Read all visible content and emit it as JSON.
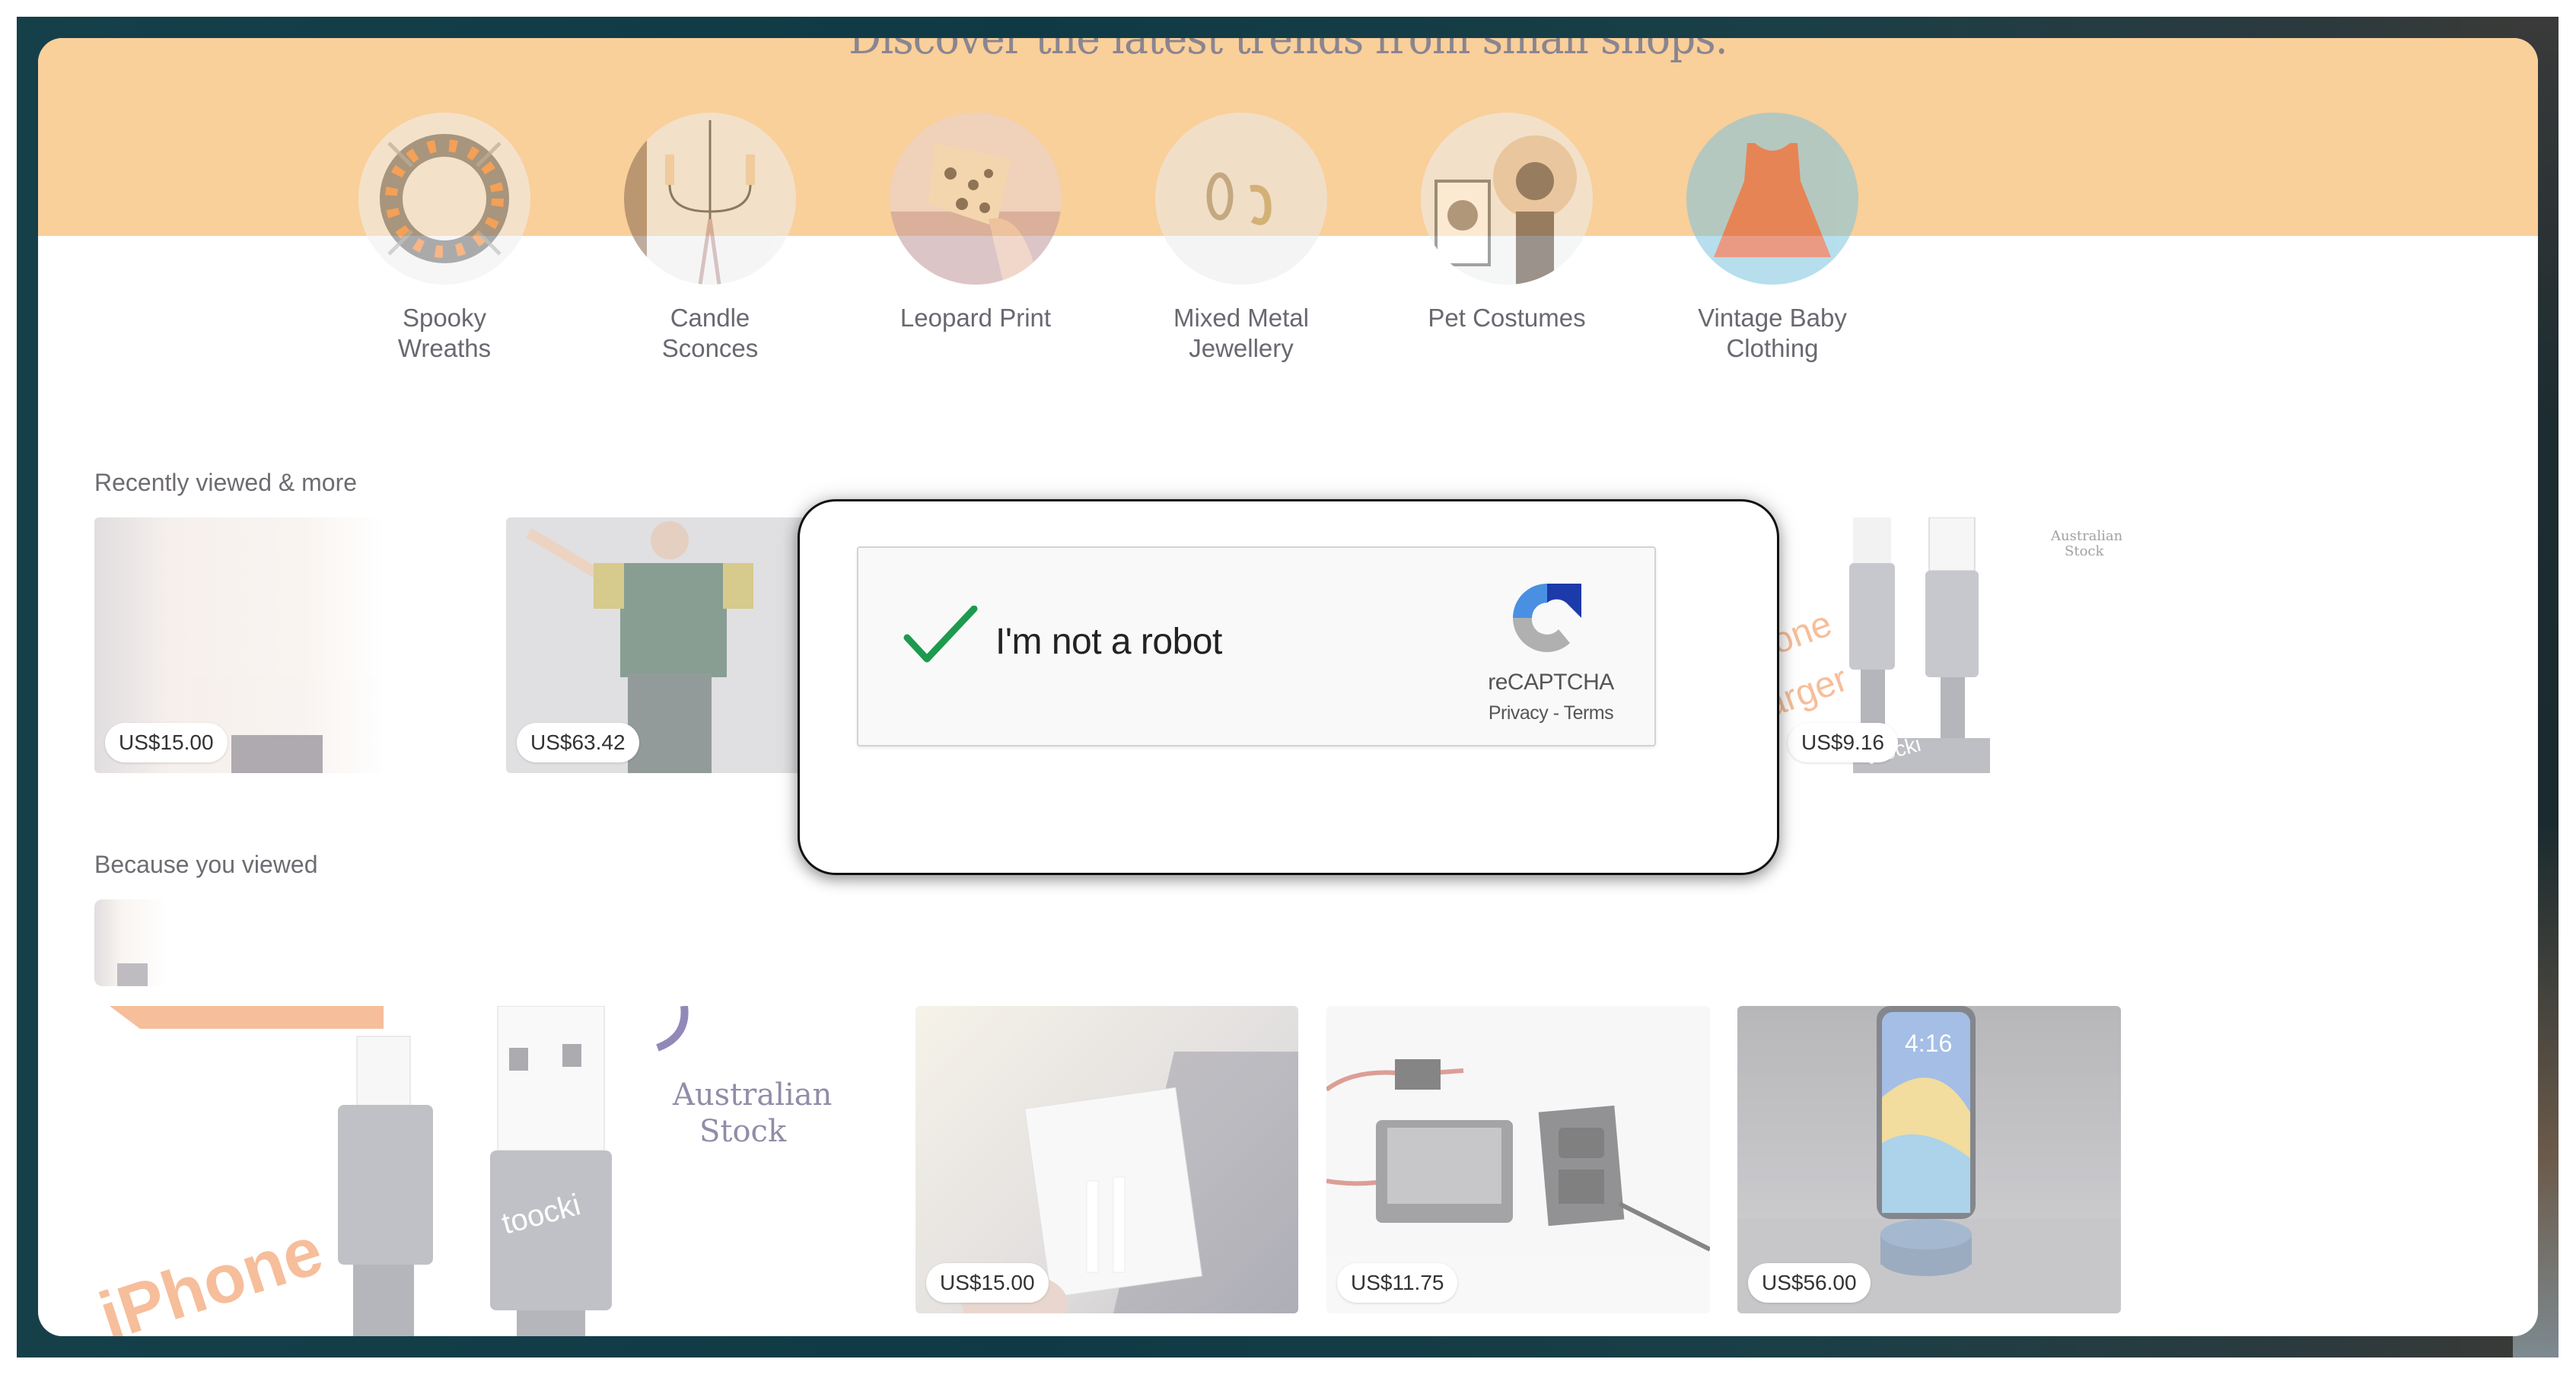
{
  "page": {
    "headline": "Discover the latest trends from small shops."
  },
  "categories": [
    {
      "label": "Spooky Wreaths",
      "line1": "Spooky",
      "line2": "Wreaths",
      "icon": "wreath-image"
    },
    {
      "label": "Candle Sconces",
      "line1": "Candle",
      "line2": "Sconces",
      "icon": "candle-sconce-image"
    },
    {
      "label": "Leopard Print",
      "line1": "Leopard Print",
      "line2": "",
      "icon": "leopard-print-image"
    },
    {
      "label": "Mixed Metal Jewellery",
      "line1": "Mixed Metal",
      "line2": "Jewellery",
      "icon": "earrings-image"
    },
    {
      "label": "Pet Costumes",
      "line1": "Pet Costumes",
      "line2": "",
      "icon": "pet-costume-image"
    },
    {
      "label": "Vintage Baby Clothing",
      "line1": "Vintage Baby",
      "line2": "Clothing",
      "icon": "baby-dress-image"
    }
  ],
  "recently_viewed": {
    "title": "Recently viewed & more",
    "items": [
      {
        "price": "US$15.00",
        "image": "power-adapter-image"
      },
      {
        "price": "US$63.42",
        "image": "tracksuit-image"
      },
      {
        "price": "US$9.16",
        "image": "iphone-charger-cable-image",
        "overlay_text": [
          "one",
          "arger"
        ],
        "caption": [
          "Australian",
          "Stock"
        ],
        "brand": "toocki"
      }
    ]
  },
  "because_you_viewed": {
    "title": "Because you viewed",
    "thumbnail": "power-adapter-thumbnail",
    "items": [
      {
        "price": "",
        "image": "iphone-cable-large-image",
        "overlay_text": "iPhone",
        "caption": [
          "Australian",
          "Stock"
        ],
        "brand": "toocki"
      },
      {
        "price": "US$15.00",
        "image": "apple-cable-box-image"
      },
      {
        "price": "US$11.75",
        "image": "usb-socket-image"
      },
      {
        "price": "US$56.00",
        "image": "phone-dock-image",
        "phone_time": "4:16"
      }
    ]
  },
  "captcha": {
    "checkbox_label": "I'm not a robot",
    "checked": true,
    "brand": "reCAPTCHA",
    "privacy_link": "Privacy",
    "separator": " - ",
    "terms_link": "Terms",
    "colors": {
      "check": "#1e9a4f",
      "logo_blue_light": "#4a90e2",
      "logo_blue_dark": "#1c3aa9",
      "logo_gray": "#b0b0b0"
    }
  },
  "theme": {
    "band_color": "#f9cf9a",
    "frame_color": "#123f49"
  }
}
